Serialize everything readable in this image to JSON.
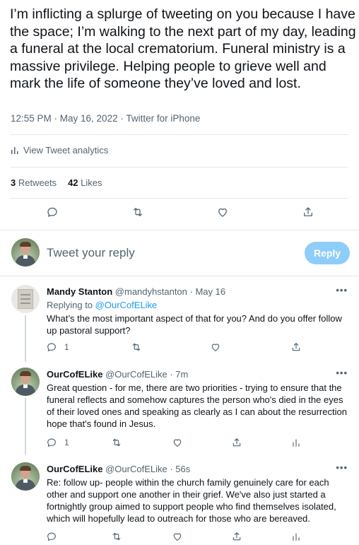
{
  "tweet": {
    "text": "I’m inflicting a splurge of tweeting on you because I have the space; I’m walking to the next part of my day, leading a funeral at the local crematorium. Funeral ministry is a massive privilege. Helping people to grieve well and mark the life of someone they’ve loved and lost.",
    "timestamp": "12:55 PM · May 16, 2022 · Twitter for iPhone",
    "analytics_label": "View Tweet analytics",
    "retweets_count": "3",
    "retweets_label": "Retweets",
    "likes_count": "42",
    "likes_label": "Likes"
  },
  "reply_composer": {
    "placeholder": "Tweet your reply",
    "button_label": "Reply"
  },
  "replies": [
    {
      "name": "Mandy Stanton",
      "handle": "@mandyhstanton",
      "time": "· May 16",
      "replying_prefix": "Replying to",
      "replying_to": "@OurCofELike",
      "text": "What’s the most important aspect of that for you? And do you offer follow up pastoral support?",
      "reply_count": "1"
    },
    {
      "name": "OurCofELike",
      "handle": "@OurCofELike",
      "time": "· 7m",
      "text": "Great question - for me, there are two priorities - trying to ensure that the funeral reflects and somehow captures the person who's died in the eyes of their loved ones and speaking as clearly as I can about the resurrection hope that's found in Jesus.",
      "reply_count": "1"
    },
    {
      "name": "OurCofELike",
      "handle": "@OurCofELike",
      "time": "· 56s",
      "text": "Re: follow up- people within the church family genuinely care for each other and support one another in their grief. We've also just started a fortnightly group aimed to support people who find themselves isolated, which will hopefully lead to outreach for those who are bereaved."
    }
  ],
  "more_label": "•••",
  "colors": {
    "accent": "#1d9bf0",
    "reply_button": "#8ecdf8",
    "muted_text": "#536471",
    "divider": "#e1e8ed"
  },
  "icons": [
    "comment-icon",
    "retweet-icon",
    "like-icon",
    "share-icon",
    "analytics-icon"
  ]
}
